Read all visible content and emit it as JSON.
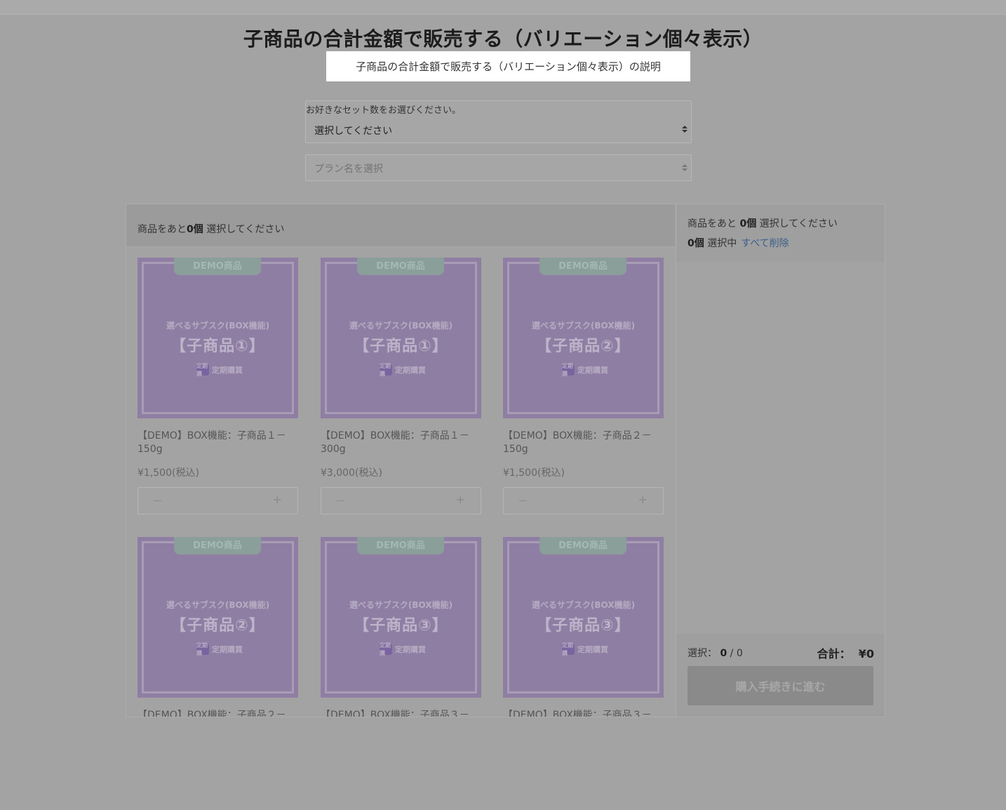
{
  "page": {
    "title": "子商品の合計金額で販売する（バリエーション個々表示）",
    "tooltip": "子商品の合計金額で販売する（バリエーション個々表示）の説明"
  },
  "set_select": {
    "label": "お好きなセット数をお選びください。",
    "value": "選択してください"
  },
  "plan_select": {
    "placeholder": "プラン名を選択"
  },
  "left_header": {
    "prefix": "商品をあと",
    "count": "0個",
    "suffix": " 選択してください"
  },
  "products": [
    {
      "name": "【DEMO】BOX機能：子商品１－150g",
      "price": "¥1,500(税込)",
      "image": {
        "tag": "DEMO商品",
        "line1": "選べるサブスク(BOX機能)",
        "line2": "【子商品①】",
        "line3": "定期購買",
        "badge": "定期購"
      },
      "minus": "－",
      "plus": "+"
    },
    {
      "name": "【DEMO】BOX機能：子商品１－300g",
      "price": "¥3,000(税込)",
      "image": {
        "tag": "DEMO商品",
        "line1": "選べるサブスク(BOX機能)",
        "line2": "【子商品①】",
        "line3": "定期購買",
        "badge": "定期購"
      },
      "minus": "－",
      "plus": "+"
    },
    {
      "name": "【DEMO】BOX機能：子商品２－150g",
      "price": "¥1,500(税込)",
      "image": {
        "tag": "DEMO商品",
        "line1": "選べるサブスク(BOX機能)",
        "line2": "【子商品②】",
        "line3": "定期購買",
        "badge": "定期購"
      },
      "minus": "－",
      "plus": "+"
    },
    {
      "name": "【DEMO】BOX機能：子商品２－",
      "price": "",
      "image": {
        "tag": "DEMO商品",
        "line1": "選べるサブスク(BOX機能)",
        "line2": "【子商品②】",
        "line3": "定期購買",
        "badge": "定期購"
      },
      "minus": "",
      "plus": ""
    },
    {
      "name": "【DEMO】BOX機能：子商品３－",
      "price": "",
      "image": {
        "tag": "DEMO商品",
        "line1": "選べるサブスク(BOX機能)",
        "line2": "【子商品③】",
        "line3": "定期購買",
        "badge": "定期購"
      },
      "minus": "",
      "plus": ""
    },
    {
      "name": "【DEMO】BOX機能：子商品３－",
      "price": "",
      "image": {
        "tag": "DEMO商品",
        "line1": "選べるサブスク(BOX機能)",
        "line2": "【子商品③】",
        "line3": "定期購買",
        "badge": "定期購"
      },
      "minus": "",
      "plus": ""
    }
  ],
  "cart": {
    "prefix": "商品をあと",
    "count": "0個",
    "suffix": " 選択してください",
    "selected_count": "0個",
    "selected_label": " 選択中",
    "clear_all": "すべて削除",
    "selection_label": "選択：",
    "selection_current": "0",
    "selection_total": " / 0",
    "total_label": "合計：",
    "total_value": "¥0",
    "checkout": "購入手続きに進む"
  }
}
